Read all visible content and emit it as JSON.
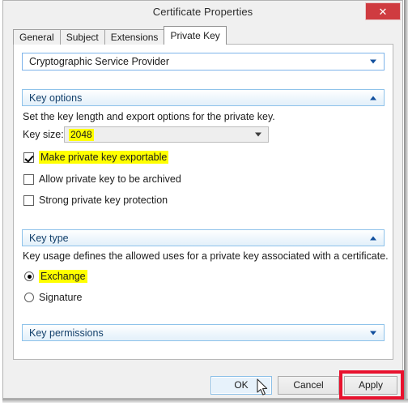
{
  "window": {
    "title": "Certificate Properties",
    "close_label": "✕"
  },
  "tabs": [
    {
      "label": "General",
      "active": false
    },
    {
      "label": "Subject",
      "active": false
    },
    {
      "label": "Extensions",
      "active": false
    },
    {
      "label": "Private Key",
      "active": true
    }
  ],
  "sections": {
    "csp": {
      "label": "Cryptographic Service Provider",
      "expanded": false,
      "chevron": "chevron-down-icon"
    },
    "key_options": {
      "label": "Key options",
      "expanded": true,
      "chevron": "chevron-up-icon",
      "description": "Set the key length and export options for the private key.",
      "key_size_label": "Key size:",
      "key_size_value": "2048",
      "checkboxes": [
        {
          "label": "Make private key exportable",
          "checked": true,
          "highlighted": true
        },
        {
          "label": "Allow private key to be archived",
          "checked": false,
          "highlighted": false
        },
        {
          "label": "Strong private key protection",
          "checked": false,
          "highlighted": false
        }
      ]
    },
    "key_type": {
      "label": "Key type",
      "expanded": true,
      "chevron": "chevron-up-icon",
      "description": "Key usage defines the allowed uses for a private key associated with a certificate.",
      "radios": [
        {
          "label": "Exchange",
          "selected": true,
          "highlighted": true
        },
        {
          "label": "Signature",
          "selected": false,
          "highlighted": false
        }
      ]
    },
    "key_permissions": {
      "label": "Key permissions",
      "expanded": false,
      "chevron": "chevron-down-icon"
    }
  },
  "footer": {
    "ok_label": "OK",
    "cancel_label": "Cancel",
    "apply_label": "Apply"
  },
  "annotations": {
    "highlight_color": "#ffff00",
    "callout_color": "#e8122e"
  }
}
